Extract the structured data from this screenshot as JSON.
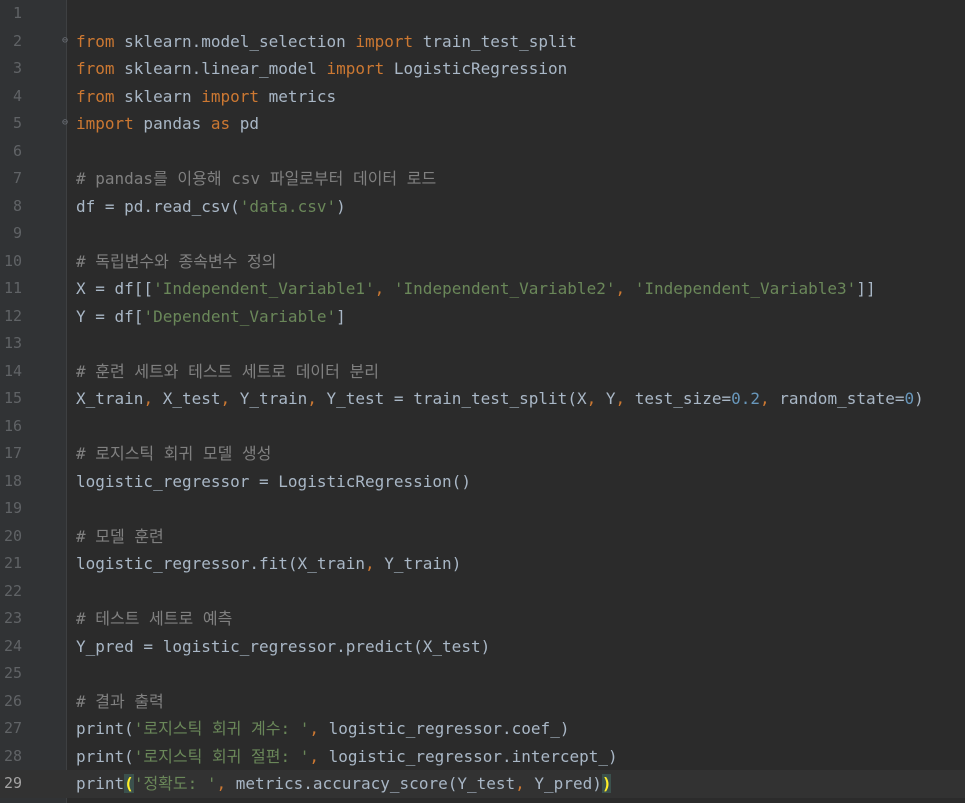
{
  "editor": {
    "language": "python",
    "current_line": 29,
    "lines": [
      {
        "n": "1",
        "segs": []
      },
      {
        "n": "2",
        "fold": true,
        "segs": [
          [
            "kw",
            "from"
          ],
          [
            "t",
            " sklearn.model_selection "
          ],
          [
            "kw",
            "import"
          ],
          [
            "t",
            " train_test_split"
          ]
        ]
      },
      {
        "n": "3",
        "segs": [
          [
            "kw",
            "from"
          ],
          [
            "t",
            " sklearn.linear_model "
          ],
          [
            "kw",
            "import"
          ],
          [
            "t",
            " LogisticRegression"
          ]
        ]
      },
      {
        "n": "4",
        "segs": [
          [
            "kw",
            "from"
          ],
          [
            "t",
            " sklearn "
          ],
          [
            "kw",
            "import"
          ],
          [
            "t",
            " metrics"
          ]
        ]
      },
      {
        "n": "5",
        "fold": true,
        "segs": [
          [
            "kw",
            "import"
          ],
          [
            "t",
            " pandas "
          ],
          [
            "kw",
            "as"
          ],
          [
            "t",
            " pd"
          ]
        ]
      },
      {
        "n": "6",
        "segs": []
      },
      {
        "n": "7",
        "segs": [
          [
            "cm",
            "# pandas를 이용해 csv 파일로부터 데이터 로드"
          ]
        ]
      },
      {
        "n": "8",
        "segs": [
          [
            "t",
            "df = pd.read_csv("
          ],
          [
            "str",
            "'data.csv'"
          ],
          [
            "t",
            ")"
          ]
        ]
      },
      {
        "n": "9",
        "segs": []
      },
      {
        "n": "10",
        "segs": [
          [
            "cm",
            "# 독립변수와 종속변수 정의"
          ]
        ]
      },
      {
        "n": "11",
        "segs": [
          [
            "t",
            "X = df[["
          ],
          [
            "str",
            "'Independent_Variable1'"
          ],
          [
            "pn",
            ","
          ],
          [
            "t",
            " "
          ],
          [
            "str",
            "'Independent_Variable2'"
          ],
          [
            "pn",
            ","
          ],
          [
            "t",
            " "
          ],
          [
            "str",
            "'Independent_Variable3'"
          ],
          [
            "t",
            "]]"
          ]
        ]
      },
      {
        "n": "12",
        "segs": [
          [
            "t",
            "Y = df["
          ],
          [
            "str",
            "'Dependent_Variable'"
          ],
          [
            "t",
            "]"
          ]
        ]
      },
      {
        "n": "13",
        "segs": []
      },
      {
        "n": "14",
        "segs": [
          [
            "cm",
            "# 훈련 세트와 테스트 세트로 데이터 분리"
          ]
        ]
      },
      {
        "n": "15",
        "segs": [
          [
            "t",
            "X_train"
          ],
          [
            "pn",
            ","
          ],
          [
            "t",
            " X_test"
          ],
          [
            "pn",
            ","
          ],
          [
            "t",
            " Y_train"
          ],
          [
            "pn",
            ","
          ],
          [
            "t",
            " Y_test = train_test_split(X"
          ],
          [
            "pn",
            ","
          ],
          [
            "t",
            " Y"
          ],
          [
            "pn",
            ","
          ],
          [
            "t",
            " test_size="
          ],
          [
            "num",
            "0.2"
          ],
          [
            "pn",
            ","
          ],
          [
            "t",
            " random_state="
          ],
          [
            "num",
            "0"
          ],
          [
            "t",
            ")"
          ]
        ]
      },
      {
        "n": "16",
        "segs": []
      },
      {
        "n": "17",
        "segs": [
          [
            "cm",
            "# 로지스틱 회귀 모델 생성"
          ]
        ]
      },
      {
        "n": "18",
        "segs": [
          [
            "t",
            "logistic_regressor = LogisticRegression()"
          ]
        ]
      },
      {
        "n": "19",
        "segs": []
      },
      {
        "n": "20",
        "segs": [
          [
            "cm",
            "# 모델 훈련"
          ]
        ]
      },
      {
        "n": "21",
        "segs": [
          [
            "t",
            "logistic_regressor.fit(X_train"
          ],
          [
            "pn",
            ","
          ],
          [
            "t",
            " Y_train)"
          ]
        ]
      },
      {
        "n": "22",
        "segs": []
      },
      {
        "n": "23",
        "segs": [
          [
            "cm",
            "# 테스트 세트로 예측"
          ]
        ]
      },
      {
        "n": "24",
        "segs": [
          [
            "t",
            "Y_pred = logistic_regressor.predict(X_test)"
          ]
        ]
      },
      {
        "n": "25",
        "segs": []
      },
      {
        "n": "26",
        "segs": [
          [
            "cm",
            "# 결과 출력"
          ]
        ]
      },
      {
        "n": "27",
        "segs": [
          [
            "t",
            "print("
          ],
          [
            "str",
            "'로지스틱 회귀 계수: '"
          ],
          [
            "pn",
            ","
          ],
          [
            "t",
            " logistic_regressor.coef_)"
          ]
        ]
      },
      {
        "n": "28",
        "segs": [
          [
            "t",
            "print("
          ],
          [
            "str",
            "'로지스틱 회귀 절편: '"
          ],
          [
            "pn",
            ","
          ],
          [
            "t",
            " logistic_regressor.intercept_)"
          ]
        ]
      },
      {
        "n": "29",
        "segs": [
          [
            "t",
            "print"
          ],
          [
            "br-hl",
            "("
          ],
          [
            "str",
            "'정확도: '"
          ],
          [
            "pn",
            ","
          ],
          [
            "t",
            " metrics.accuracy_score(Y_test"
          ],
          [
            "pn",
            ","
          ],
          [
            "t",
            " Y_pred)"
          ],
          [
            "br-hl",
            ")"
          ]
        ]
      }
    ]
  },
  "colors": {
    "background": "#2b2b2b",
    "gutter": "#313335",
    "keyword": "#cc7832",
    "string": "#6a8759",
    "number": "#6897bb",
    "comment": "#808080",
    "text": "#a9b7c6",
    "current_line": "#323232"
  },
  "icons": {
    "fold": "fold-marker-icon"
  }
}
